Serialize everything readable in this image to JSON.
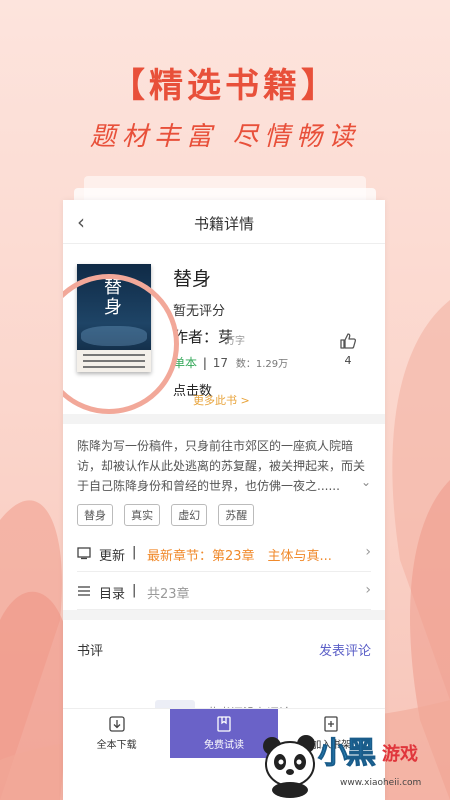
{
  "promo": {
    "headline": "【精选书籍】",
    "subline": "题材丰富 尽情畅读"
  },
  "nav": {
    "back_icon": "chevron-left-icon",
    "title": "书籍详情"
  },
  "book": {
    "cover_title": "替身",
    "title": "替身",
    "rating": "暂无评分",
    "author": "作者：芽",
    "word_unit": "万字",
    "type": "单本",
    "pipe": "|",
    "trunc_count": "17",
    "count_label": "数：1.29万",
    "click_label": "点击数",
    "more_link": "更多此书 >",
    "like_icon": "thumbs-up-icon",
    "like_count": "4"
  },
  "description": {
    "text": "陈降为写一份稿件，只身前往市郊区的一座疯人院暗访，却被认作从此处逃离的苏复醒，被关押起来，而关于自己陈降身份和曾经的世界，也仿佛一夜之......",
    "expand_icon": "chevron-down-icon"
  },
  "tags": [
    "替身",
    "真实",
    "虚幻",
    "苏醒"
  ],
  "update_row": {
    "icon": "update-icon",
    "label": "更新",
    "bar": "|",
    "latest": "最新章节：第23章　主体与真..."
  },
  "catalog_row": {
    "icon": "list-icon",
    "label": "目录",
    "bar": "|",
    "count": "共23章"
  },
  "comments": {
    "header": "书评",
    "post_link": "发表评论",
    "empty_text": "此书还没有评论"
  },
  "bottom_bar": {
    "download": "全本下载",
    "trial": "免费试读",
    "shelf": "加入书架"
  },
  "watermark": {
    "logo": "小黑",
    "logo2": "游戏",
    "url": "www.xiaoheii.com"
  },
  "colors": {
    "accent": "#e8503a",
    "purple": "#6a62c8",
    "orange": "#f08a2c",
    "green": "#35a85a"
  }
}
